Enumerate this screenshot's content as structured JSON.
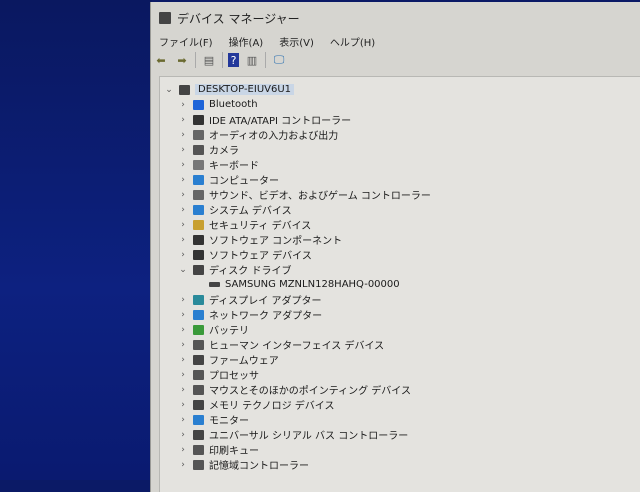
{
  "window": {
    "title": "デバイス マネージャー"
  },
  "menu": [
    "ファイル(F)",
    "操作(A)",
    "表示(V)",
    "ヘルプ(H)"
  ],
  "toolbar": [
    {
      "icon": "back-arrow-icon",
      "glyph": "⬅"
    },
    {
      "icon": "forward-arrow-icon",
      "glyph": "➡"
    },
    {
      "icon": "properties-icon",
      "glyph": "▤"
    },
    {
      "icon": "help-icon",
      "glyph": "?"
    },
    {
      "icon": "action-pane-icon",
      "glyph": "▥"
    },
    {
      "icon": "monitor-scan-icon",
      "glyph": "🖵"
    }
  ],
  "tree": {
    "root": "DESKTOP-EIUV6U1",
    "items": [
      {
        "label": "Bluetooth",
        "icon": "bluetooth-icon",
        "color": "#1e64d8",
        "expanded": false
      },
      {
        "label": "IDE ATA/ATAPI コントローラー",
        "icon": "ide-controller-icon",
        "color": "#333333",
        "expanded": false
      },
      {
        "label": "オーディオの入力および出力",
        "icon": "speaker-icon",
        "color": "#666666",
        "expanded": false
      },
      {
        "label": "カメラ",
        "icon": "camera-icon",
        "color": "#555555",
        "expanded": false
      },
      {
        "label": "キーボード",
        "icon": "keyboard-icon",
        "color": "#777777",
        "expanded": false
      },
      {
        "label": "コンピューター",
        "icon": "computer-icon",
        "color": "#2a7fd0",
        "expanded": false
      },
      {
        "label": "サウンド、ビデオ、およびゲーム コントローラー",
        "icon": "sound-icon",
        "color": "#666666",
        "expanded": false
      },
      {
        "label": "システム デバイス",
        "icon": "system-device-icon",
        "color": "#2a7fd0",
        "expanded": false
      },
      {
        "label": "セキュリティ デバイス",
        "icon": "security-device-icon",
        "color": "#c8a030",
        "expanded": false
      },
      {
        "label": "ソフトウェア コンポーネント",
        "icon": "software-component-icon",
        "color": "#333333",
        "expanded": false
      },
      {
        "label": "ソフトウェア デバイス",
        "icon": "software-device-icon",
        "color": "#333333",
        "expanded": false
      },
      {
        "label": "ディスク ドライブ",
        "icon": "disk-drive-icon",
        "color": "#444444",
        "expanded": true,
        "children": [
          "SAMSUNG MZNLN128HAHQ-00000"
        ]
      },
      {
        "label": "ディスプレイ アダプター",
        "icon": "display-adapter-icon",
        "color": "#2a8a9a",
        "expanded": false
      },
      {
        "label": "ネットワーク アダプター",
        "icon": "network-adapter-icon",
        "color": "#2a7fd0",
        "expanded": false
      },
      {
        "label": "バッテリ",
        "icon": "battery-icon",
        "color": "#3a9a3a",
        "expanded": false
      },
      {
        "label": "ヒューマン インターフェイス デバイス",
        "icon": "hid-icon",
        "color": "#555555",
        "expanded": false
      },
      {
        "label": "ファームウェア",
        "icon": "firmware-icon",
        "color": "#444444",
        "expanded": false
      },
      {
        "label": "プロセッサ",
        "icon": "processor-icon",
        "color": "#555555",
        "expanded": false
      },
      {
        "label": "マウスとそのほかのポインティング デバイス",
        "icon": "mouse-icon",
        "color": "#555555",
        "expanded": false
      },
      {
        "label": "メモリ テクノロジ デバイス",
        "icon": "memory-icon",
        "color": "#444444",
        "expanded": false
      },
      {
        "label": "モニター",
        "icon": "monitor-icon",
        "color": "#2a7fd0",
        "expanded": false
      },
      {
        "label": "ユニバーサル シリアル バス コントローラー",
        "icon": "usb-icon",
        "color": "#444444",
        "expanded": false
      },
      {
        "label": "印刷キュー",
        "icon": "printer-icon",
        "color": "#555555",
        "expanded": false
      },
      {
        "label": "記憶域コントローラー",
        "icon": "storage-controller-icon",
        "color": "#555555",
        "expanded": false
      }
    ]
  }
}
